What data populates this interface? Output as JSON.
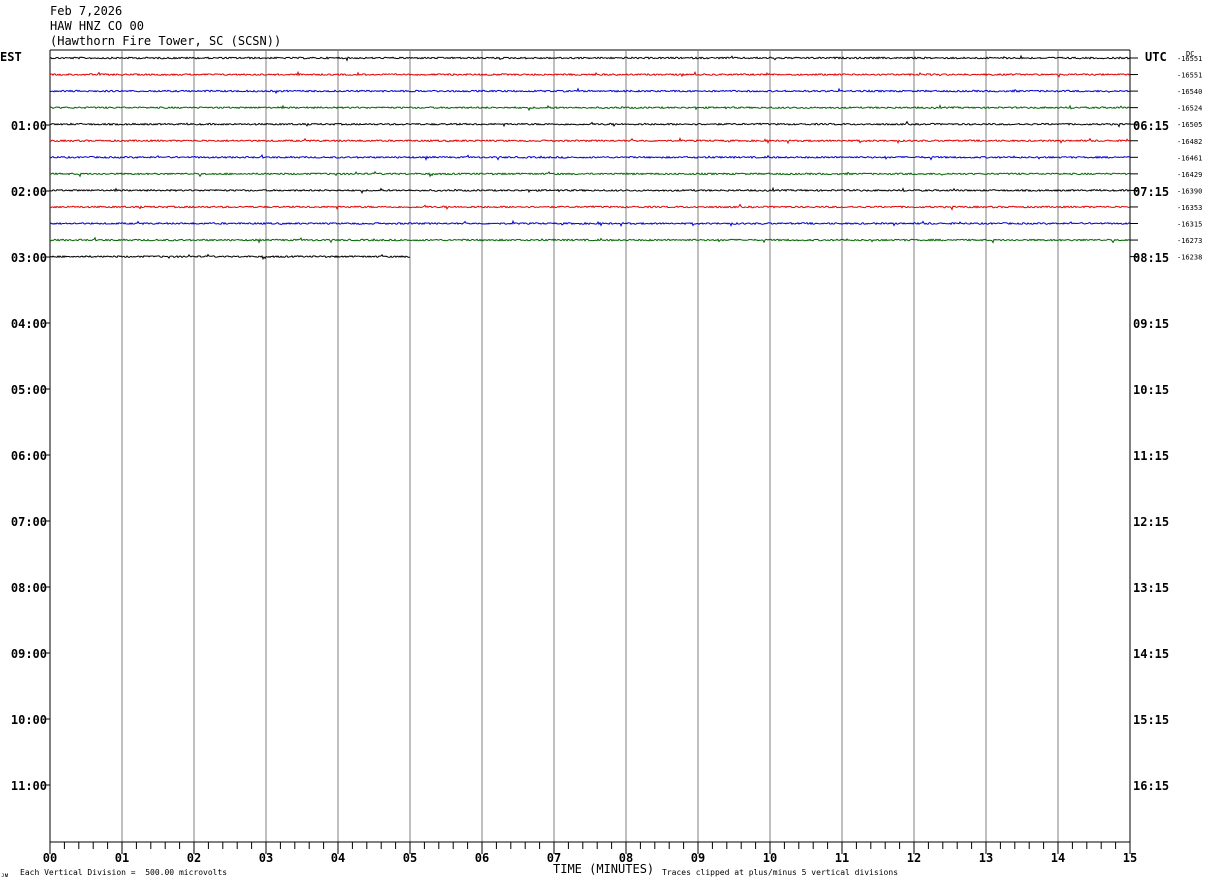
{
  "header": {
    "date": "Feb 7,2026",
    "channel": "HAW HNZ CO 00",
    "station": "(Hawthorn Fire Tower, SC (SCSN))"
  },
  "chart_data": {
    "type": "line",
    "title": "Feb 7,2026 HAW HNZ CO 00 (Hawthorn Fire Tower, SC (SCSN))",
    "xlabel": "TIME (MINUTES)",
    "x_ticks": [
      "00",
      "01",
      "02",
      "03",
      "04",
      "05",
      "06",
      "07",
      "08",
      "09",
      "10",
      "11",
      "12",
      "13",
      "14",
      "15"
    ],
    "xlim": [
      0,
      15
    ],
    "left_axis_label": "EST",
    "right_axis_label": "UTC",
    "dc_label": "DC",
    "left_time_labels": [
      "01:00",
      "02:00",
      "03:00",
      "04:00",
      "05:00",
      "06:00",
      "07:00",
      "08:00",
      "09:00",
      "10:00",
      "11:00"
    ],
    "right_time_labels": [
      "06:15",
      "07:15",
      "08:15",
      "09:15",
      "10:15",
      "11:15",
      "12:15",
      "13:15",
      "14:15",
      "15:15",
      "16:15"
    ],
    "trace_colors": [
      "#000000",
      "#e00000",
      "#0000d0",
      "#006400"
    ],
    "series": [
      {
        "dc": "-16551",
        "end_minute": 15
      },
      {
        "dc": "-16551",
        "end_minute": 15
      },
      {
        "dc": "-16540",
        "end_minute": 15
      },
      {
        "dc": "-16524",
        "end_minute": 15
      },
      {
        "dc": "-16505",
        "end_minute": 15
      },
      {
        "dc": "-16482",
        "end_minute": 15
      },
      {
        "dc": "-16461",
        "end_minute": 15
      },
      {
        "dc": "-16429",
        "end_minute": 15
      },
      {
        "dc": "-16390",
        "end_minute": 15
      },
      {
        "dc": "-16353",
        "end_minute": 15
      },
      {
        "dc": "-16315",
        "end_minute": 15
      },
      {
        "dc": "-16273",
        "end_minute": 15
      },
      {
        "dc": "-16238",
        "end_minute": 5
      }
    ]
  },
  "footer": {
    "scale_note": "Each Vertical Division =  500.00 microvolts",
    "clip_note": "Traces clipped at plus/minus 5 vertical divisions",
    "corner_mark": "ᴊᴍ"
  }
}
